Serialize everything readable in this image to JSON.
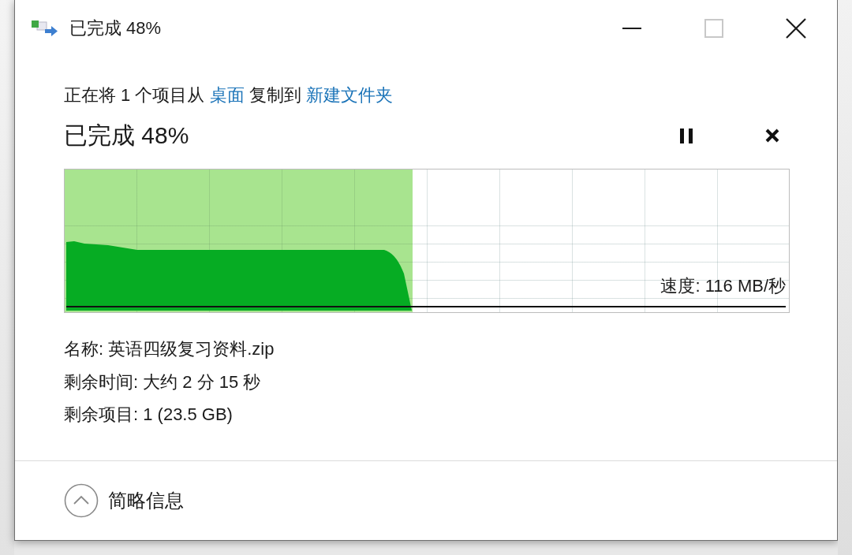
{
  "window": {
    "title": "已完成 48%",
    "controls": [
      {
        "kind": "minimize",
        "disabled": false
      },
      {
        "kind": "maximize",
        "disabled": true
      },
      {
        "kind": "close",
        "disabled": false
      }
    ]
  },
  "copy_line": [
    {
      "kind": "text",
      "text": "正在将 1 个项目从"
    },
    {
      "kind": "link",
      "text": "桌面"
    },
    {
      "kind": "text",
      "text": "复制到"
    },
    {
      "kind": "link",
      "text": "新建文件夹"
    }
  ],
  "status": {
    "heading": "已完成 48%",
    "controls": [
      {
        "kind": "pause"
      },
      {
        "kind": "cancel"
      }
    ]
  },
  "progress": {
    "level": 0.48,
    "speed_label": "速度: 116 MB/秒"
  },
  "details": [
    "名称: 英语四级复习资料.zip",
    "剩余时间: 大约 2 分 15 秒",
    "剩余项目: 1 (23.5 GB)"
  ],
  "footer": {
    "toggle_label": "简略信息",
    "expanded": true
  }
}
